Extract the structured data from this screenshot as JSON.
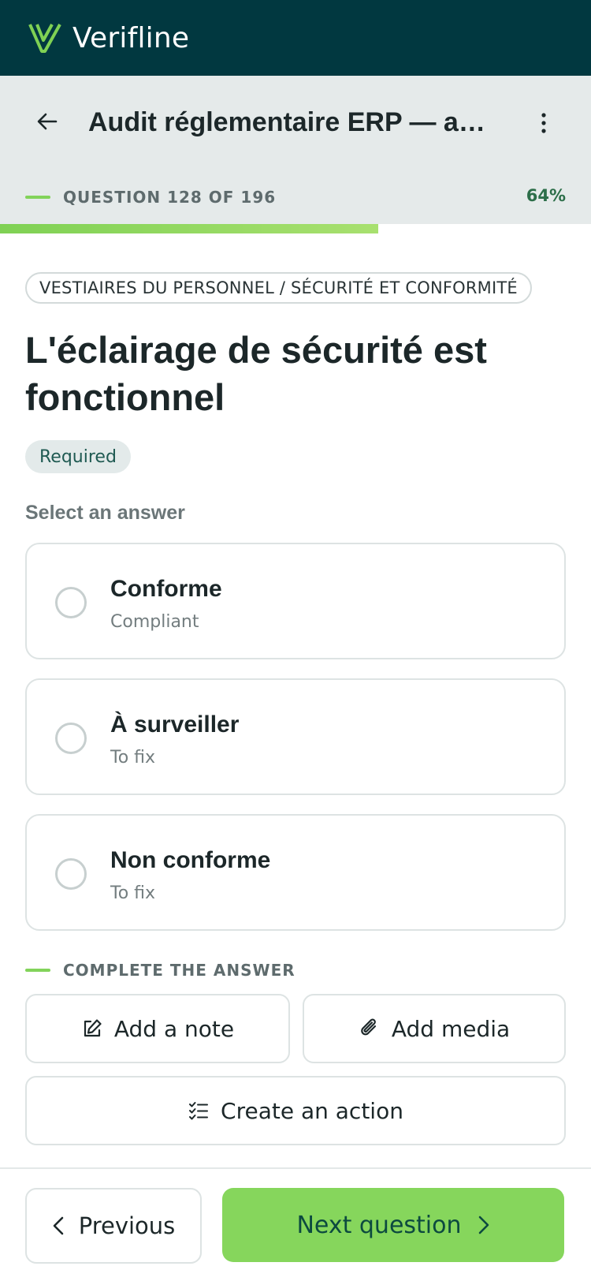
{
  "app": {
    "name": "Verifline"
  },
  "header": {
    "title": "Audit réglementaire ERP — ann...",
    "question_counter": "QUESTION 128 OF 196",
    "progress_percent_label": "64%",
    "progress_fraction": 0.64
  },
  "question": {
    "category": "VESTIAIRES DU PERSONNEL / SÉCURITÉ ET CONFORMITÉ",
    "title": "L'éclairage de sécurité est fonctionnel",
    "required_label": "Required",
    "select_label": "Select an answer",
    "options": [
      {
        "title": "Conforme",
        "subtitle": "Compliant"
      },
      {
        "title": "À surveiller",
        "subtitle": "To fix"
      },
      {
        "title": "Non conforme",
        "subtitle": "To fix"
      }
    ]
  },
  "complete": {
    "label": "COMPLETE THE ANSWER",
    "add_note": "Add a note",
    "add_media": "Add media",
    "create_action": "Create an action"
  },
  "footer": {
    "previous": "Previous",
    "next": "Next question"
  },
  "colors": {
    "brand_dark": "#013840",
    "accent_green": "#86d65c",
    "percent_text": "#2c6e49"
  }
}
